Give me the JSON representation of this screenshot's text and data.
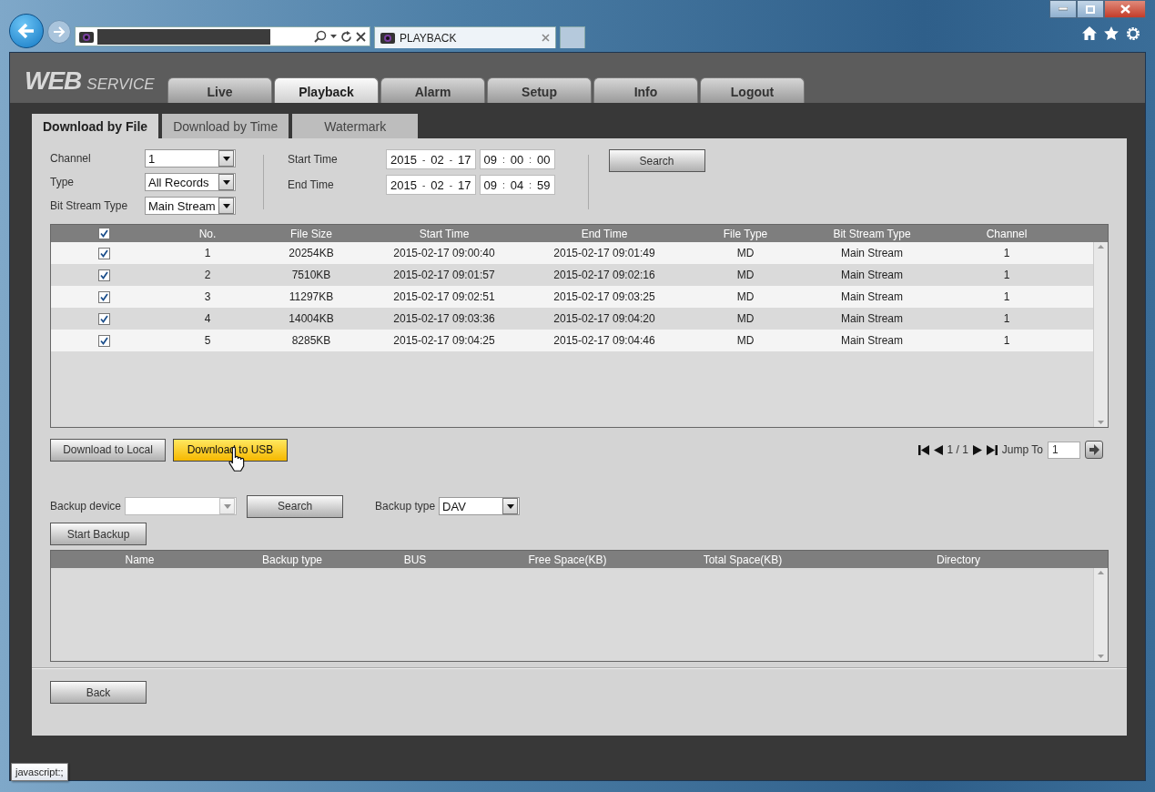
{
  "browser": {
    "tab_title": "PLAYBACK"
  },
  "logo": {
    "main": "WEB",
    "sub": "SERVICE"
  },
  "nav_tabs": [
    {
      "label": "Live",
      "selected": false
    },
    {
      "label": "Playback",
      "selected": true
    },
    {
      "label": "Alarm",
      "selected": false
    },
    {
      "label": "Setup",
      "selected": false
    },
    {
      "label": "Info",
      "selected": false
    },
    {
      "label": "Logout",
      "selected": false
    }
  ],
  "sub_tabs": [
    {
      "label": "Download by File",
      "selected": true
    },
    {
      "label": "Download by Time",
      "selected": false
    },
    {
      "label": "Watermark",
      "selected": false
    }
  ],
  "filters": [
    {
      "label": "Channel",
      "value": "1"
    },
    {
      "label": "Type",
      "value": "All Records"
    },
    {
      "label": "Bit Stream Type",
      "value": "Main Stream"
    }
  ],
  "times": [
    {
      "label": "Start Time",
      "date": [
        "2015",
        "-",
        "02",
        "-",
        "17"
      ],
      "time": [
        "09",
        ":",
        "00",
        ":",
        "00"
      ]
    },
    {
      "label": "End Time",
      "date": [
        "2015",
        "-",
        "02",
        "-",
        "17"
      ],
      "time": [
        "09",
        ":",
        "04",
        ":",
        "59"
      ]
    }
  ],
  "search_button": "Search",
  "table": {
    "all_checked": true,
    "columns": [
      "No.",
      "File Size",
      "Start Time",
      "End Time",
      "File Type",
      "Bit Stream Type",
      "Channel"
    ],
    "rows": [
      {
        "checked": true,
        "cells": [
          "1",
          "20254KB",
          "2015-02-17 09:00:40",
          "2015-02-17 09:01:49",
          "MD",
          "Main Stream",
          "1"
        ]
      },
      {
        "checked": true,
        "cells": [
          "2",
          "7510KB",
          "2015-02-17 09:01:57",
          "2015-02-17 09:02:16",
          "MD",
          "Main Stream",
          "1"
        ]
      },
      {
        "checked": true,
        "cells": [
          "3",
          "11297KB",
          "2015-02-17 09:02:51",
          "2015-02-17 09:03:25",
          "MD",
          "Main Stream",
          "1"
        ]
      },
      {
        "checked": true,
        "cells": [
          "4",
          "14004KB",
          "2015-02-17 09:03:36",
          "2015-02-17 09:04:20",
          "MD",
          "Main Stream",
          "1"
        ]
      },
      {
        "checked": true,
        "cells": [
          "5",
          "8285KB",
          "2015-02-17 09:04:25",
          "2015-02-17 09:04:46",
          "MD",
          "Main Stream",
          "1"
        ]
      }
    ]
  },
  "actions": [
    {
      "label": "Download to Local",
      "hovered": false
    },
    {
      "label": "Download to USB",
      "hovered": true
    }
  ],
  "pagination": {
    "page": "1 / 1",
    "jump_label": "Jump To",
    "jump_value": "1"
  },
  "backup": {
    "device_label": "Backup device",
    "search_button": "Search",
    "type_label": "Backup type",
    "type_value": "DAV",
    "start_button": "Start Backup",
    "columns": [
      "Name",
      "Backup type",
      "BUS",
      "Free Space(KB)",
      "Total Space(KB)",
      "Directory"
    ]
  },
  "back_button": "Back",
  "status_tooltip": "javascript:;"
}
